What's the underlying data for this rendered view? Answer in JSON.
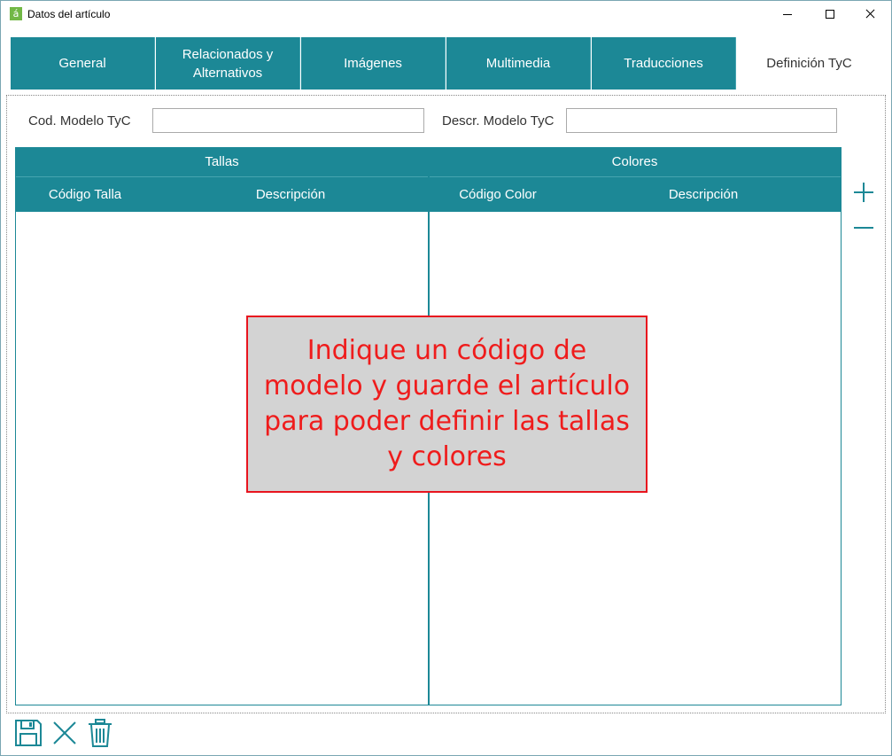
{
  "window": {
    "title": "Datos del artículo",
    "app_icon_glyph": "á"
  },
  "tabs": [
    {
      "label": "General",
      "active": false
    },
    {
      "label": "Relacionados y Alternativos",
      "active": false
    },
    {
      "label": "Imágenes",
      "active": false
    },
    {
      "label": "Multimedia",
      "active": false
    },
    {
      "label": "Traducciones",
      "active": false
    },
    {
      "label": "Definición TyC",
      "active": true
    }
  ],
  "form": {
    "cod_modelo_label": "Cod. Modelo TyC",
    "cod_modelo_value": "",
    "descr_modelo_label": "Descr. Modelo TyC",
    "descr_modelo_value": ""
  },
  "grid": {
    "tallas": {
      "title": "Tallas",
      "columns": [
        "Código Talla",
        "Descripción"
      ],
      "rows": []
    },
    "colores": {
      "title": "Colores",
      "columns": [
        "Código Color",
        "Descripción"
      ],
      "rows": []
    }
  },
  "overlay": {
    "message": "Indique un código de modelo y guarde el artículo para poder definir las tallas y colores"
  },
  "icons": {
    "add": "plus-icon",
    "remove": "minus-icon",
    "save": "save-icon",
    "cancel": "close-icon",
    "delete": "trash-icon"
  },
  "colors": {
    "accent": "#1c8896",
    "overlay_bg": "#d3d3d3",
    "overlay_border": "#e8141e",
    "overlay_text": "#ef1c1c"
  }
}
